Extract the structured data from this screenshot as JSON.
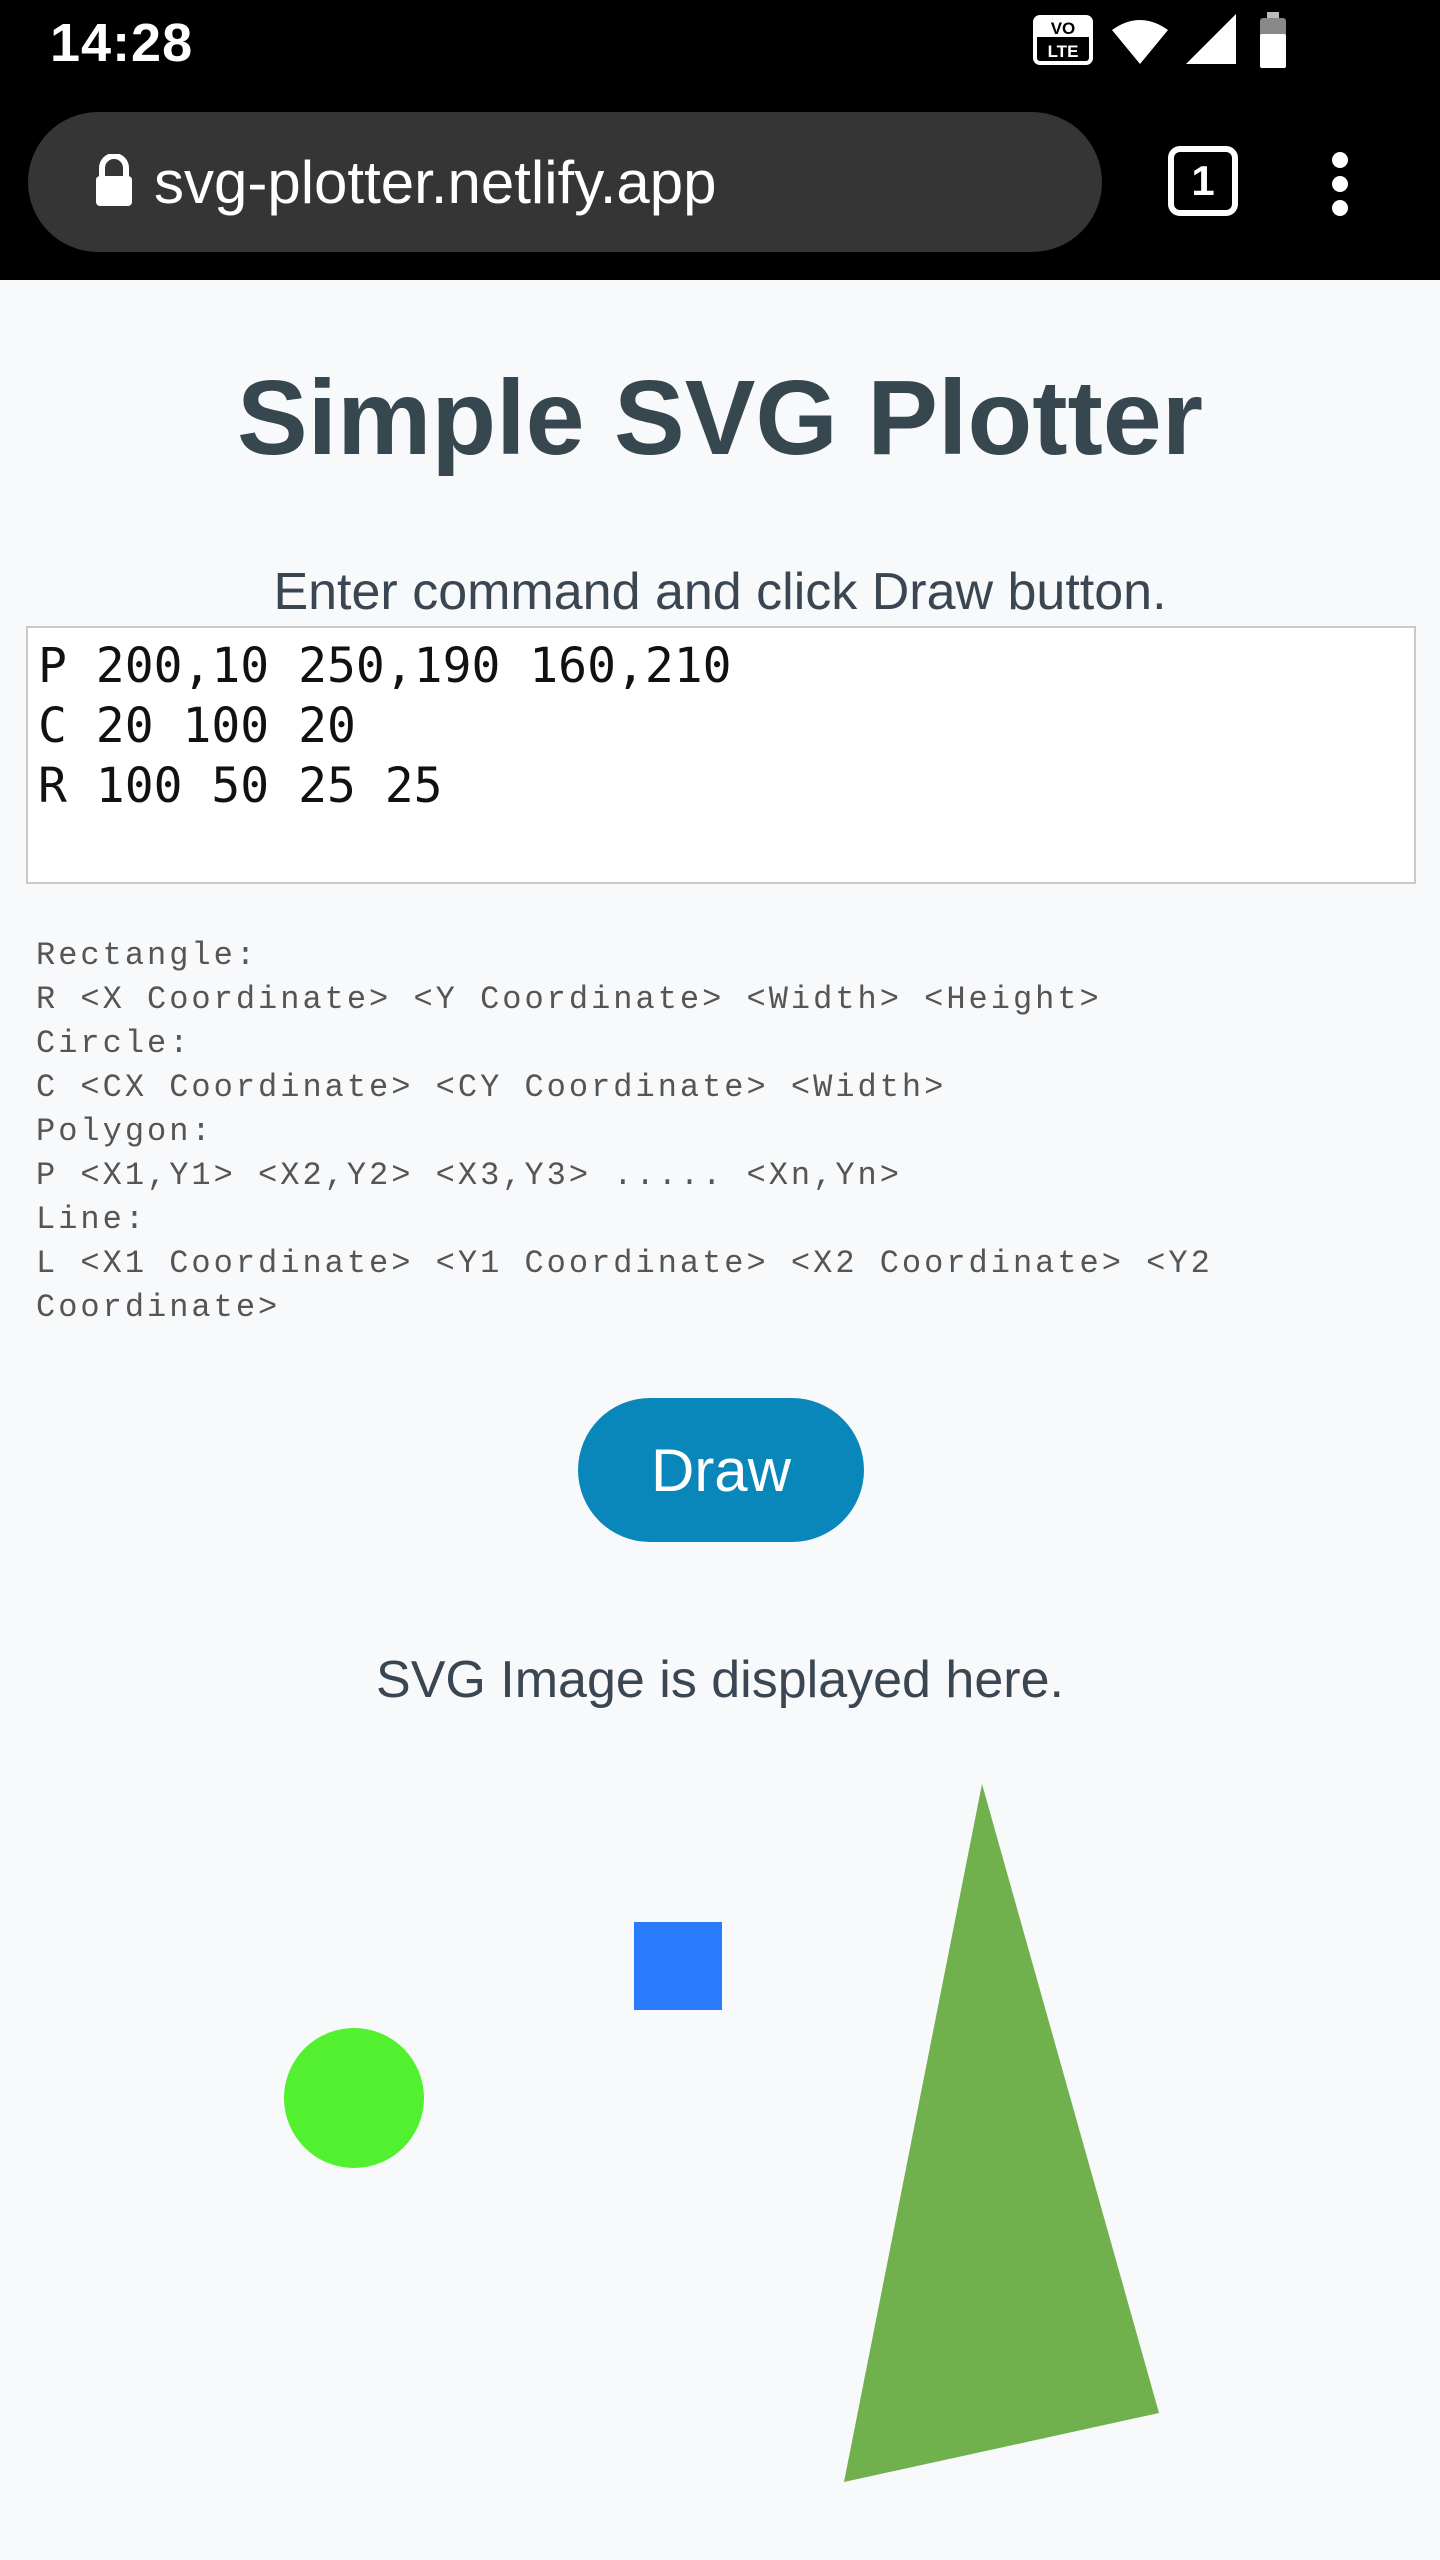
{
  "status_bar": {
    "time": "14:28",
    "icons": [
      "volte-icon",
      "wifi-icon",
      "signal-icon",
      "battery-icon"
    ],
    "volte_label": "VO\nLTE"
  },
  "browser": {
    "url": "svg-plotter.netlify.app",
    "tab_count": "1"
  },
  "page": {
    "title": "Simple SVG Plotter",
    "instructions": "Enter command and click Draw button.",
    "command_value": "P 200,10 250,190 160,210\nC 20 100 20\nR 100 50 25 25",
    "help_text": "Rectangle:\nR <X Coordinate> <Y Coordinate> <Width> <Height>\nCircle:\nC <CX Coordinate> <CY Coordinate> <Width>\nPolygon:\nP <X1,Y1> <X2,Y2> <X3,Y3> ..... <Xn,Yn>\nLine:\nL <X1 Coordinate> <Y1 Coordinate> <X2 Coordinate> <Y2 Coordinate>",
    "draw_label": "Draw",
    "svg_caption": "SVG Image is displayed here."
  },
  "colors": {
    "polygon": "#70b04d",
    "circle": "#52f02f",
    "rectangle": "#2b7cfd",
    "draw_button": "#0a87ba"
  }
}
